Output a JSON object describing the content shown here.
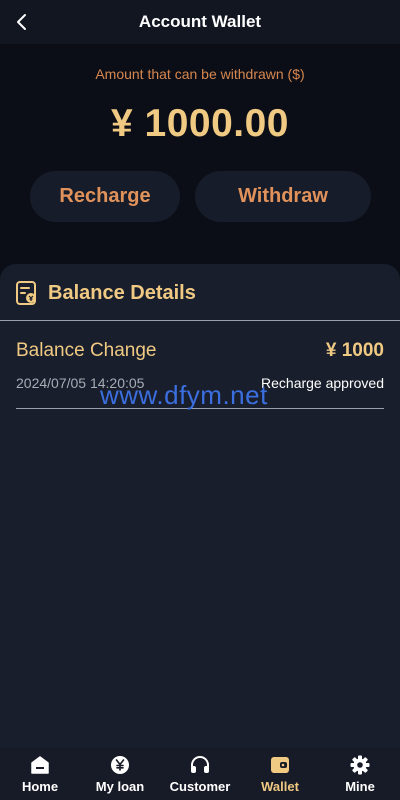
{
  "header": {
    "title": "Account Wallet"
  },
  "wallet": {
    "withdrawable_label": "Amount that can be withdrawn ($)",
    "amount": "¥ 1000.00"
  },
  "actions": {
    "recharge_label": "Recharge",
    "withdraw_label": "Withdraw"
  },
  "balance_details": {
    "title": "Balance Details",
    "entries": [
      {
        "title": "Balance Change",
        "amount": "¥ 1000",
        "date": "2024/07/05 14:20:05",
        "status": "Recharge approved"
      }
    ]
  },
  "watermark": "www.dfym.net",
  "tabbar": {
    "items": [
      {
        "label": "Home",
        "icon": "home-icon"
      },
      {
        "label": "My loan",
        "icon": "yen-coin-icon"
      },
      {
        "label": "Customer",
        "icon": "headset-icon"
      },
      {
        "label": "Wallet",
        "icon": "wallet-icon"
      },
      {
        "label": "Mine",
        "icon": "gear-icon"
      }
    ],
    "active": "Wallet"
  },
  "colors": {
    "accent": "#f0c983",
    "button_text": "#e0925a",
    "background": "#0b0e16",
    "panel": "#181e2c"
  }
}
